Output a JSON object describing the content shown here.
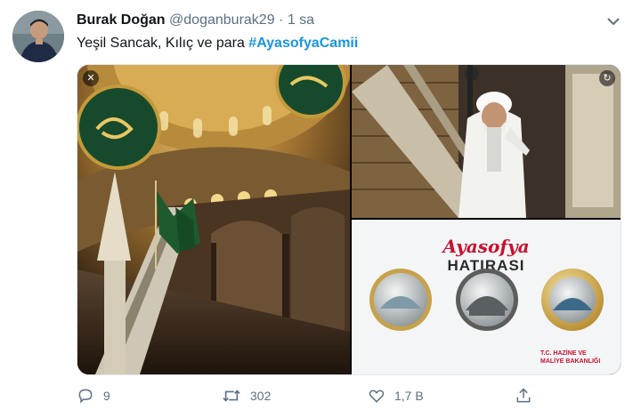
{
  "tweet": {
    "author_name": "Burak Doğan",
    "author_handle": "@doganburak29",
    "separator": "·",
    "time": "1 sa",
    "text": "Yeşil Sancak, Kılıç ve para",
    "hashtag": "#AyasofyaCamii"
  },
  "media": {
    "close_glyph": "✕",
    "rotate_glyph": "↻",
    "coin_card": {
      "title_script": "Ayasofya",
      "title_caps": "HATIRASI",
      "ministry_right": "T.C. HAZİNE VE MALİYE BAKANLIĞI"
    }
  },
  "actions": {
    "reply_count": "9",
    "retweet_count": "302",
    "like_count": "1,7 B",
    "reply_icon": "reply-icon",
    "retweet_icon": "retweet-icon",
    "like_icon": "heart-icon",
    "share_icon": "share-icon"
  },
  "colors": {
    "accent": "#1b95e0",
    "secondary_text": "#5b7083"
  }
}
